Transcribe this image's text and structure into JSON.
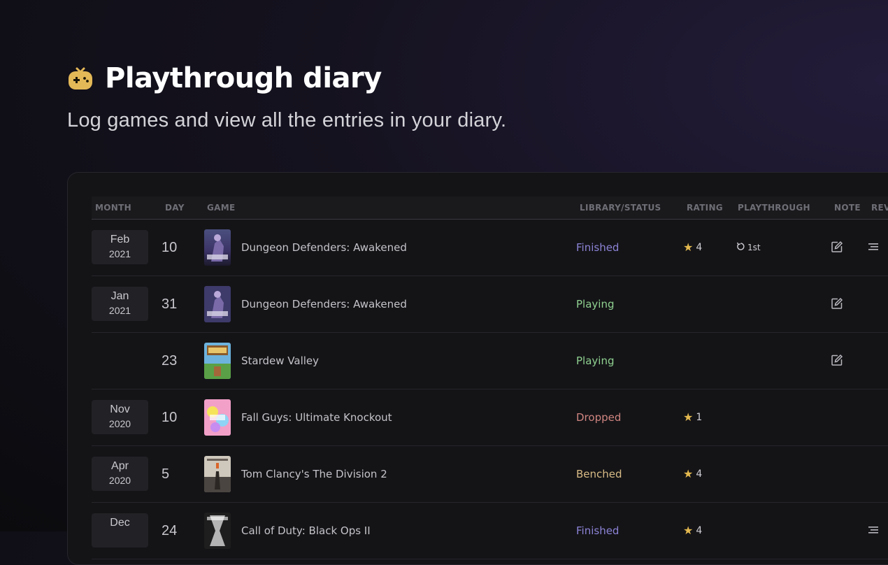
{
  "header": {
    "icon": "gamepad-icon",
    "title": "Playthrough diary",
    "subtitle": "Log games and view all the entries in your diary."
  },
  "table": {
    "columns": {
      "month": "MONTH",
      "day": "DAY",
      "game": "GAME",
      "status": "LIBRARY/STATUS",
      "rating": "RATING",
      "playthrough": "PLAYTHROUGH",
      "note": "NOTE",
      "review": "REV"
    },
    "rows": [
      {
        "month": "Feb",
        "year": "2021",
        "day": "10",
        "game": "Dungeon Defenders: Awakened",
        "status": "Finished",
        "rating": "4",
        "playthrough": "1st",
        "note": true,
        "review": true
      },
      {
        "month": "Jan",
        "year": "2021",
        "day": "31",
        "game": "Dungeon Defenders: Awakened",
        "status": "Playing",
        "rating": "",
        "playthrough": "",
        "note": true,
        "review": false
      },
      {
        "month": "",
        "year": "",
        "day": "23",
        "game": "Stardew Valley",
        "status": "Playing",
        "rating": "",
        "playthrough": "",
        "note": true,
        "review": false
      },
      {
        "month": "Nov",
        "year": "2020",
        "day": "10",
        "game": "Fall Guys: Ultimate Knockout",
        "status": "Dropped",
        "rating": "1",
        "playthrough": "",
        "note": false,
        "review": false
      },
      {
        "month": "Apr",
        "year": "2020",
        "day": "5",
        "game": "Tom Clancy's The Division 2",
        "status": "Benched",
        "rating": "4",
        "playthrough": "",
        "note": false,
        "review": false
      },
      {
        "month": "Dec",
        "year": "",
        "day": "24",
        "game": "Call of Duty: Black Ops II",
        "status": "Finished",
        "rating": "4",
        "playthrough": "",
        "note": false,
        "review": true
      }
    ]
  },
  "colors": {
    "Finished": "#8c83d6",
    "Playing": "#8fd08f",
    "Dropped": "#d08580",
    "Benched": "#d8bb86",
    "star": "#e4b94f"
  }
}
